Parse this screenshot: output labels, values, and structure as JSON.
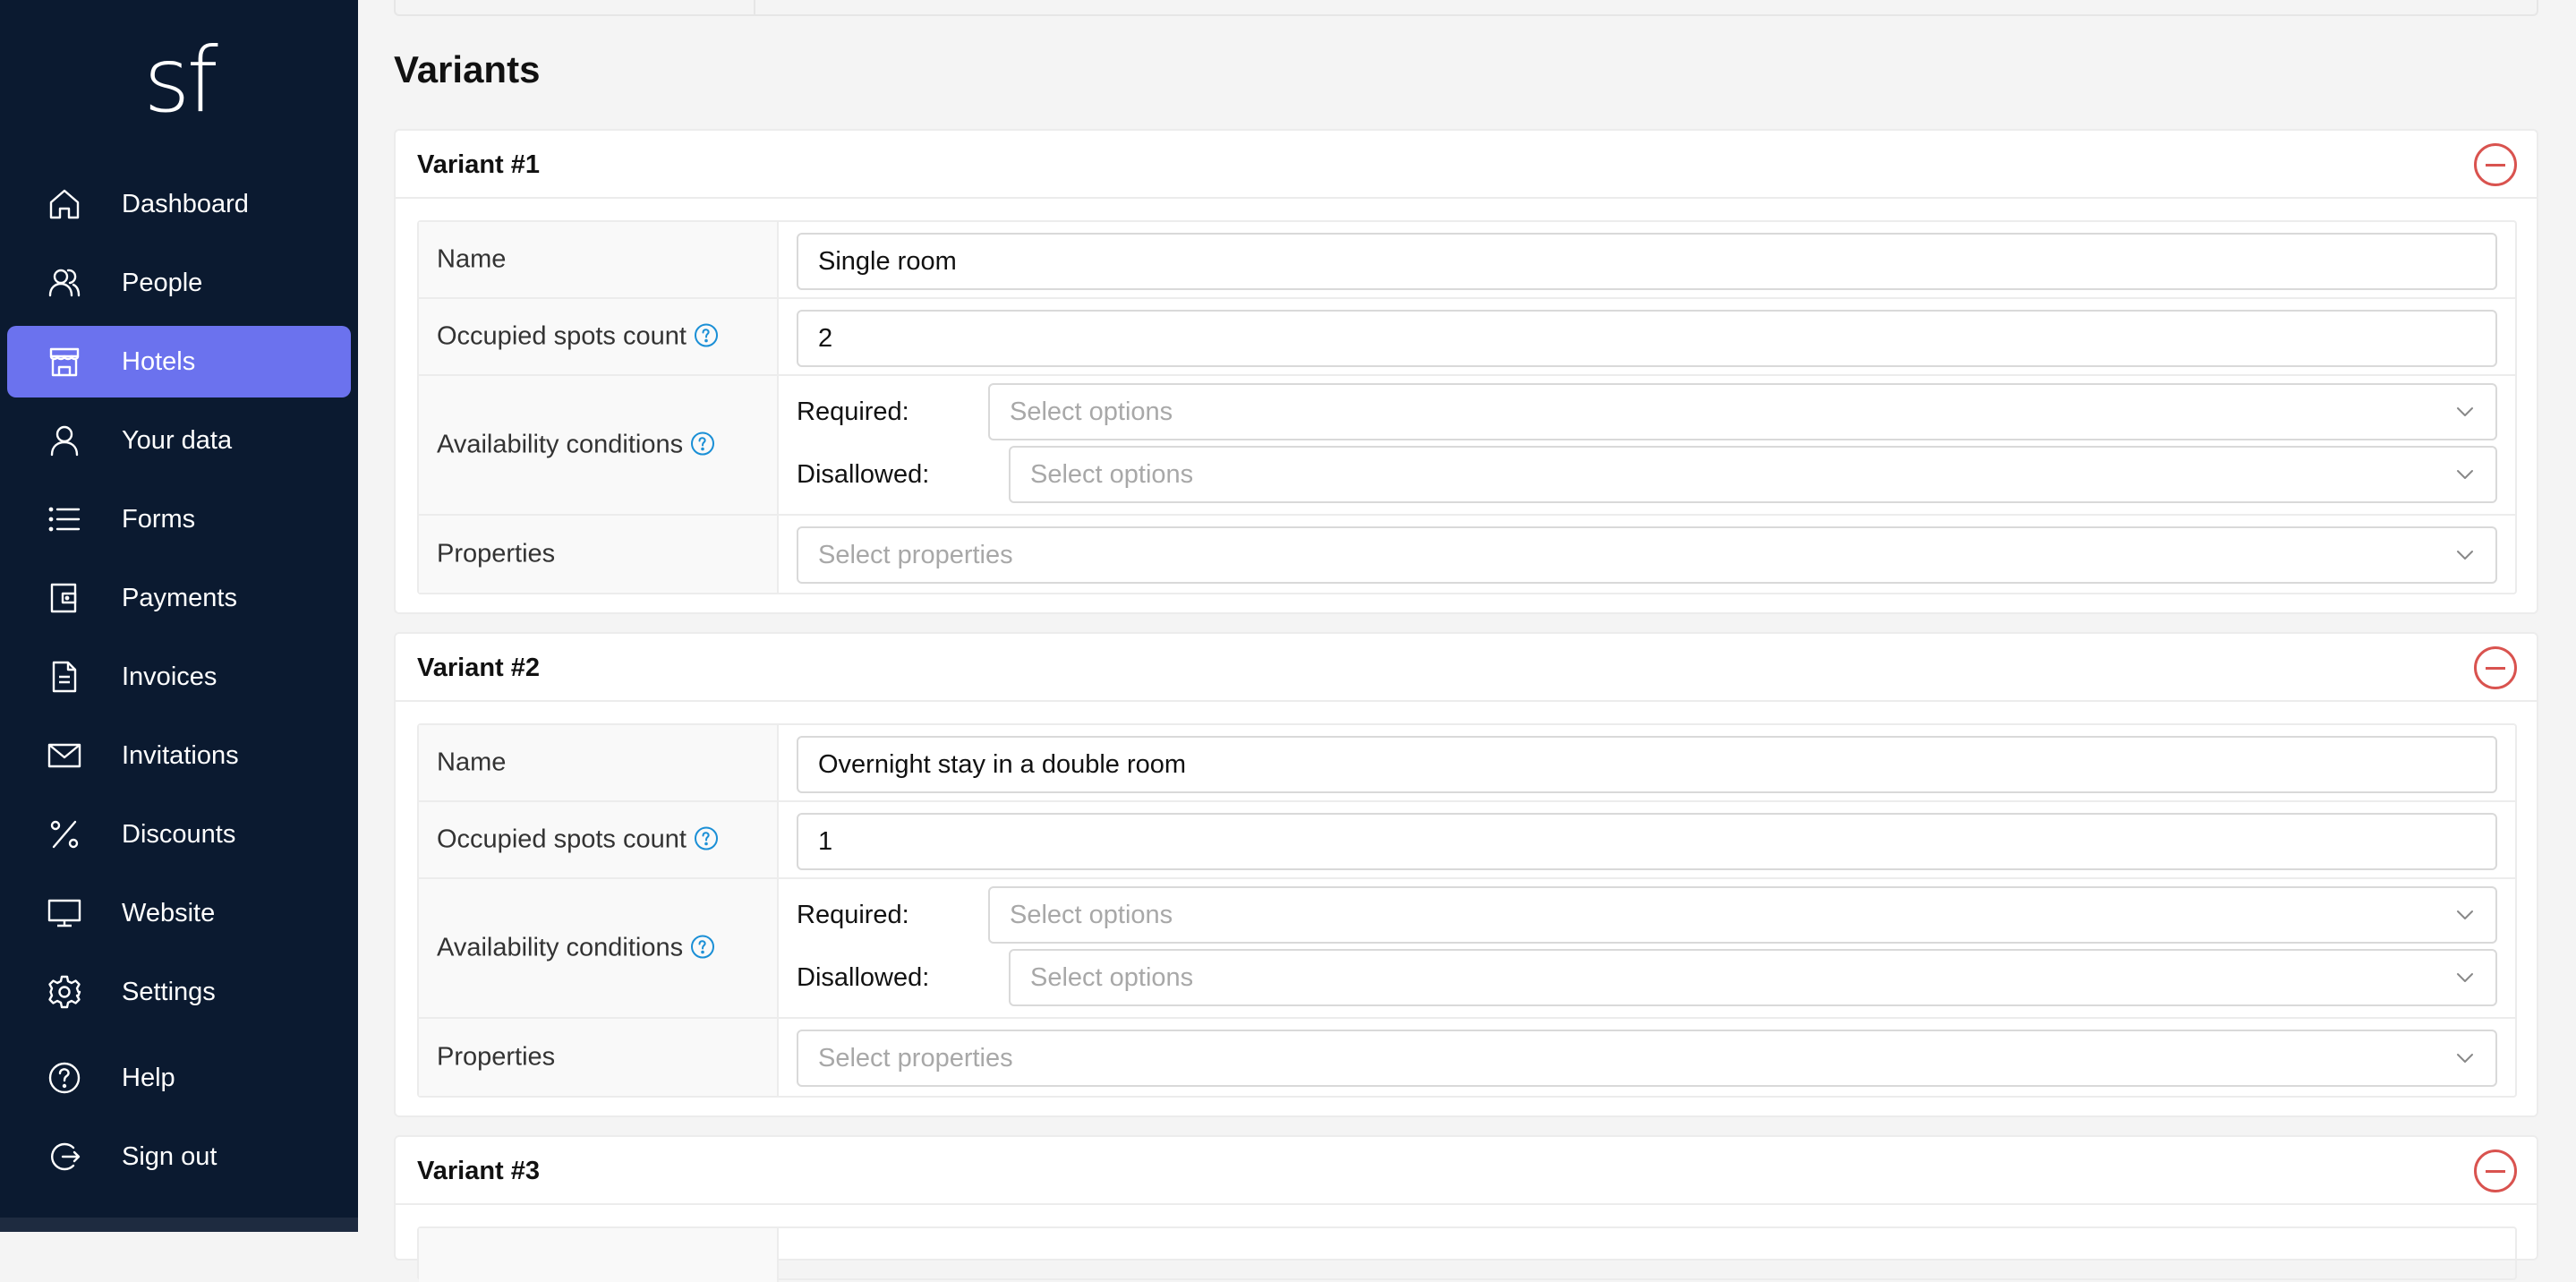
{
  "app": {
    "logo_text": "sf"
  },
  "sidebar": {
    "items": [
      {
        "label": "Dashboard",
        "icon": "home-icon",
        "active": false
      },
      {
        "label": "People",
        "icon": "people-icon",
        "active": false
      },
      {
        "label": "Hotels",
        "icon": "store-icon",
        "active": true
      },
      {
        "label": "Your data",
        "icon": "user-icon",
        "active": false
      },
      {
        "label": "Forms",
        "icon": "list-icon",
        "active": false
      },
      {
        "label": "Payments",
        "icon": "wallet-icon",
        "active": false
      },
      {
        "label": "Invoices",
        "icon": "document-icon",
        "active": false
      },
      {
        "label": "Invitations",
        "icon": "envelope-icon",
        "active": false
      },
      {
        "label": "Discounts",
        "icon": "percent-icon",
        "active": false
      },
      {
        "label": "Website",
        "icon": "monitor-icon",
        "active": false
      },
      {
        "label": "Settings",
        "icon": "gear-icon",
        "active": false
      },
      {
        "label": "Help",
        "icon": "help-circle-icon",
        "active": false
      },
      {
        "label": "Sign out",
        "icon": "sign-out-icon",
        "active": false
      }
    ],
    "active_color": "#6b72ee",
    "background_color": "#0b1a30"
  },
  "main": {
    "section_title": "Variants",
    "labels": {
      "name": "Name",
      "occupied_spots": "Occupied spots count",
      "availability": "Availability conditions",
      "properties": "Properties",
      "required": "Required:",
      "disallowed": "Disallowed:"
    },
    "placeholders": {
      "options": "Select options",
      "properties": "Select properties"
    },
    "variants": [
      {
        "title": "Variant #1",
        "name": "Single room",
        "occupied_spots": "2"
      },
      {
        "title": "Variant #2",
        "name": "Overnight stay in a double room",
        "occupied_spots": "1"
      },
      {
        "title": "Variant #3"
      }
    ],
    "remove_color": "#d9534f",
    "help_color": "#1a8fd6"
  }
}
